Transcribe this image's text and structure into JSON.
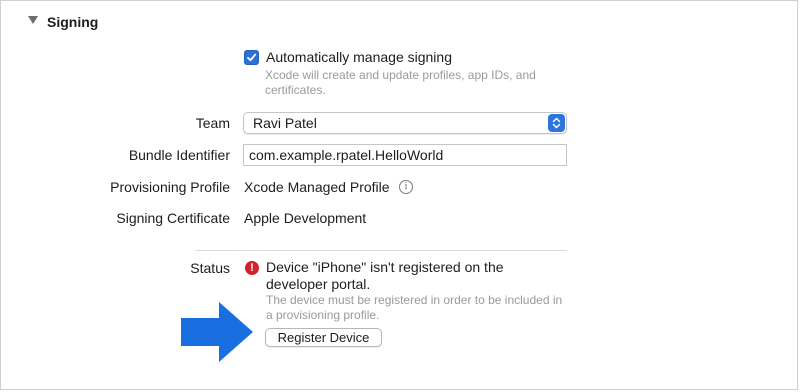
{
  "section": {
    "title": "Signing"
  },
  "auto_signing": {
    "label": "Automatically manage signing",
    "checked": true,
    "help": "Xcode will create and update profiles, app IDs, and certificates."
  },
  "fields": {
    "team": {
      "label": "Team",
      "value": "Ravi Patel"
    },
    "bundle_identifier": {
      "label": "Bundle Identifier",
      "value": "com.example.rpatel.HelloWorld"
    },
    "provisioning_profile": {
      "label": "Provisioning Profile",
      "value": "Xcode Managed Profile"
    },
    "signing_certificate": {
      "label": "Signing Certificate",
      "value": "Apple Development"
    }
  },
  "status": {
    "label": "Status",
    "message": "Device \"iPhone\" isn't registered on the developer portal.",
    "help": "The device must be registered in order to be included in a provisioning profile.",
    "button_label": "Register Device"
  },
  "colors": {
    "accent": "#2b6fd8",
    "error": "#d2232a",
    "arrow": "#1a6fe0"
  }
}
